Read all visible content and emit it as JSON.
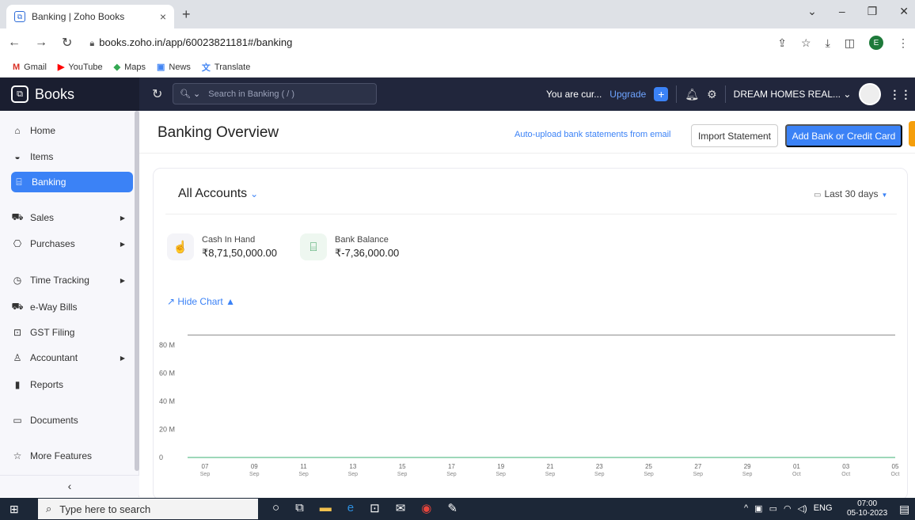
{
  "browser": {
    "tab_title": "Banking | Zoho Books",
    "tab_close": "×",
    "new_tab": "+",
    "url": "books.zoho.in/app/60023821181#/banking",
    "profile_letter": "E",
    "bookmarks": [
      {
        "label": "Gmail",
        "icon": "M",
        "color": "#d93025"
      },
      {
        "label": "YouTube",
        "icon": "▶",
        "color": "#ff0000"
      },
      {
        "label": "Maps",
        "icon": "◆",
        "color": "#34a853"
      },
      {
        "label": "News",
        "icon": "▣",
        "color": "#4285f4"
      },
      {
        "label": "Translate",
        "icon": "文",
        "color": "#4285f4"
      }
    ]
  },
  "app": {
    "brand": "Books",
    "search_placeholder": "Search in Banking ( / )",
    "trial_text": "You are cur...",
    "upgrade_label": "Upgrade",
    "org_name": "DREAM HOMES REAL... ⌄"
  },
  "sidebar": {
    "items": [
      {
        "label": "Home",
        "icon": "⌂",
        "top": 0
      },
      {
        "label": "Items",
        "icon": "◒"
      },
      {
        "label": "Banking",
        "icon": "⌸"
      },
      {
        "label": "Sales",
        "icon": "⛟"
      },
      {
        "label": "Purchases",
        "icon": "⎔"
      },
      {
        "label": "Time Tracking",
        "icon": "◷"
      },
      {
        "label": "e-Way Bills",
        "icon": "⛟"
      },
      {
        "label": "GST Filing",
        "icon": "⊡"
      },
      {
        "label": "Accountant",
        "icon": "♙"
      },
      {
        "label": "Reports",
        "icon": "▮"
      },
      {
        "label": "Documents",
        "icon": "▭"
      },
      {
        "label": "More Features",
        "icon": "☆"
      }
    ],
    "collapse": "‹"
  },
  "main": {
    "title": "Banking Overview",
    "auto_upload_link": "Auto-upload bank statements from email",
    "import_button": "Import Statement",
    "add_button": "Add Bank or Credit Card",
    "accounts_title": "All Accounts",
    "date_range": "Last 30 days",
    "stats": [
      {
        "label": "Cash In Hand",
        "value": "₹8,71,50,000.00"
      },
      {
        "label": "Bank Balance",
        "value": "₹-7,36,000.00"
      }
    ],
    "hide_chart": "Hide Chart"
  },
  "chart_data": {
    "type": "line",
    "x": [
      "07 Sep",
      "09 Sep",
      "11 Sep",
      "13 Sep",
      "15 Sep",
      "17 Sep",
      "19 Sep",
      "21 Sep",
      "23 Sep",
      "25 Sep",
      "27 Sep",
      "29 Sep",
      "01 Oct",
      "03 Oct",
      "05 Oct"
    ],
    "x_ticks": [
      [
        "07",
        "Sep"
      ],
      [
        "09",
        "Sep"
      ],
      [
        "11",
        "Sep"
      ],
      [
        "13",
        "Sep"
      ],
      [
        "15",
        "Sep"
      ],
      [
        "17",
        "Sep"
      ],
      [
        "19",
        "Sep"
      ],
      [
        "21",
        "Sep"
      ],
      [
        "23",
        "Sep"
      ],
      [
        "25",
        "Sep"
      ],
      [
        "27",
        "Sep"
      ],
      [
        "29",
        "Sep"
      ],
      [
        "01",
        "Oct"
      ],
      [
        "03",
        "Oct"
      ],
      [
        "05",
        "Oct"
      ]
    ],
    "y_ticks": [
      "0",
      "20 M",
      "40 M",
      "60 M",
      "80 M"
    ],
    "ylim": [
      0,
      80000000
    ],
    "series": [
      {
        "values": [
          87150000,
          87150000,
          87150000,
          87150000,
          87150000,
          87150000,
          87150000,
          87150000,
          87150000,
          87150000,
          87150000,
          87150000,
          87150000,
          87150000,
          87150000
        ],
        "color": "#888888"
      },
      {
        "values": [
          0,
          0,
          0,
          0,
          0,
          0,
          0,
          0,
          0,
          0,
          0,
          0,
          0,
          0,
          0
        ],
        "color": "#3bb273"
      }
    ],
    "grid": false
  },
  "taskbar": {
    "search_placeholder": "Type here to search",
    "lang": "ENG",
    "time": "07:00",
    "date": "05-10-2023"
  }
}
